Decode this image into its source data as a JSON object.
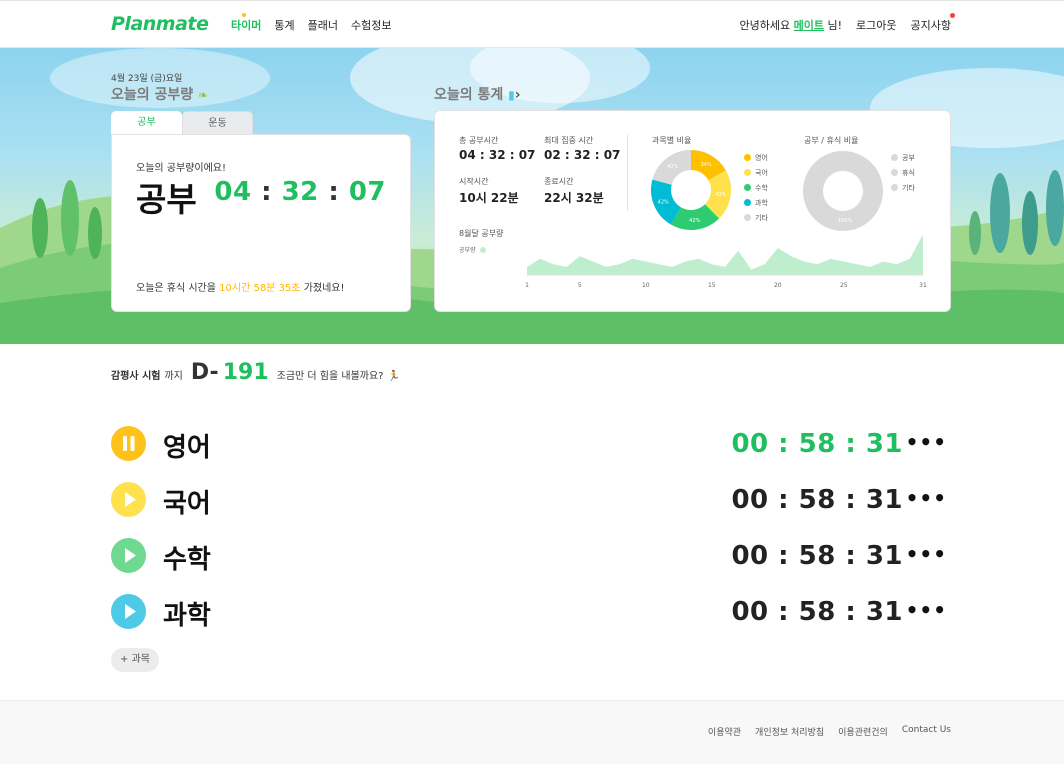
{
  "header": {
    "logo": "Planmate",
    "nav": [
      {
        "label": "타이머",
        "active": true
      },
      {
        "label": "통계",
        "active": false
      },
      {
        "label": "플래너",
        "active": false
      },
      {
        "label": "수험정보",
        "active": false
      }
    ],
    "greeting_prefix": "안녕하세요",
    "nickname": "메이트",
    "greeting_suffix": "님!",
    "logout": "로그아웃",
    "notice": "공지사항"
  },
  "today": {
    "date": "4월 23일 (금)요일",
    "title": "오늘의 공부량",
    "tabs": [
      "공부",
      "운동"
    ],
    "subtitle": "오늘의 공부량이에요!",
    "label": "공부",
    "time": {
      "h": "04",
      "m": "32",
      "s": "07"
    },
    "rest_prefix": "오늘은 휴식 시간을",
    "rest_time": "10시간 58분 35초",
    "rest_suffix": "가졌네요!"
  },
  "stats": {
    "title": "오늘의 통계",
    "total_label": "총 공부시간",
    "total_value": "04 : 32 : 07",
    "focus_label": "최대 집중 시간",
    "focus_value": "02 : 32 : 07",
    "start_label": "시작시간",
    "start_value": "10시 22분",
    "end_label": "종료시간",
    "end_value": "22시 32분",
    "subject_ratio_title": "과목별 비율",
    "study_rest_title": "공부 / 휴식 비율",
    "monthly_title": "8월달 공부량",
    "monthly_legend": "공부량",
    "x_ticks": [
      "1",
      "5",
      "10",
      "15",
      "20",
      "25",
      "31"
    ]
  },
  "chart_data": [
    {
      "type": "pie",
      "title": "과목별 비율",
      "labels": [
        "영어",
        "국어",
        "수학",
        "과학",
        "기타"
      ],
      "values": [
        34,
        42,
        42,
        42,
        42
      ],
      "colors": [
        "#ffc000",
        "#ffe14d",
        "#2ecc71",
        "#00bcd4",
        "#d9d9d9"
      ]
    },
    {
      "type": "pie",
      "title": "공부 / 휴식 비율",
      "labels": [
        "공부",
        "휴식",
        "기타"
      ],
      "values": [
        100,
        0,
        0
      ],
      "slice_labels": [
        "100%"
      ],
      "colors": [
        "#d9d9d9",
        "#d9d9d9",
        "#d9d9d9"
      ]
    },
    {
      "type": "area",
      "title": "8월달 공부량",
      "series": [
        {
          "name": "공부량",
          "values": [
            3,
            6,
            4,
            3,
            7,
            5,
            3,
            4,
            6,
            5,
            4,
            3,
            5,
            6,
            4,
            3,
            9,
            2,
            4,
            10,
            7,
            5,
            4,
            6,
            5,
            4,
            3,
            5,
            4,
            6,
            15
          ]
        }
      ],
      "x": [
        1,
        2,
        3,
        4,
        5,
        6,
        7,
        8,
        9,
        10,
        11,
        12,
        13,
        14,
        15,
        16,
        17,
        18,
        19,
        20,
        21,
        22,
        23,
        24,
        25,
        26,
        27,
        28,
        29,
        30,
        31
      ],
      "xticks": [
        "1",
        "5",
        "10",
        "15",
        "20",
        "25",
        "31"
      ],
      "color": "#bfeecf"
    }
  ],
  "dday": {
    "exam": "감평사 시험",
    "until": "까지",
    "d": "D-",
    "num": "191",
    "cheer": "조금만 더 힘을 내볼까요?"
  },
  "subjects": [
    {
      "name": "영어",
      "time": "00 : 58 : 31",
      "state": "running",
      "color": "#ffc21a"
    },
    {
      "name": "국어",
      "time": "00 : 58 : 31",
      "state": "paused",
      "color": "#ffe14d"
    },
    {
      "name": "수학",
      "time": "00 : 58 : 31",
      "state": "paused",
      "color": "#6ed98f"
    },
    {
      "name": "과학",
      "time": "00 : 58 : 31",
      "state": "paused",
      "color": "#4dcbe6"
    }
  ],
  "add_subject": "+ 과목",
  "footer": [
    "이용약관",
    "개인정보 처리방침",
    "이용관련건의",
    "Contact Us"
  ]
}
